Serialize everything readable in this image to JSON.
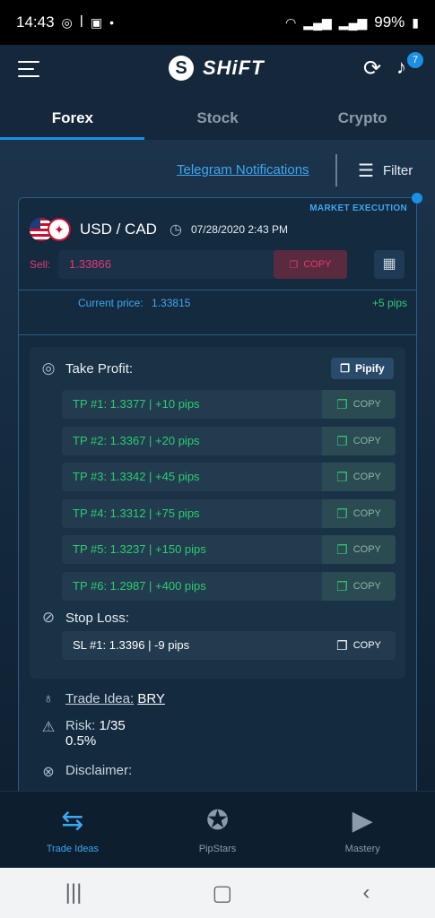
{
  "status": {
    "time": "14:43",
    "left_icons": [
      "whatsapp-icon",
      "shazam-icon",
      "shopping-bag-icon",
      "dot-icon"
    ],
    "battery": "99%"
  },
  "header": {
    "brand": "SHiFT",
    "notification_count": "7",
    "tabs": [
      "Forex",
      "Stock",
      "Crypto"
    ],
    "active_tab": "Forex"
  },
  "toolbar": {
    "telegram": "Telegram Notifications",
    "filter": "Filter"
  },
  "signal": {
    "execution": "MARKET EXECUTION",
    "pair": "USD / CAD",
    "datetime": "07/28/2020 2:43 PM",
    "sell_label": "Sell:",
    "sell_price": "1.33866",
    "copy_label": "COPY",
    "current_label": "Current price:",
    "current_price": "1.33815",
    "current_pips": "+5 pips",
    "take_profit_label": "Take Profit:",
    "pipify_label": "Pipify",
    "take_profits": [
      "TP #1: 1.3377 | +10 pips",
      "TP #2: 1.3367 | +20 pips",
      "TP #3: 1.3342 | +45 pips",
      "TP #4: 1.3312 | +75 pips",
      "TP #5: 1.3237 | +150 pips",
      "TP #6: 1.2987 | +400 pips"
    ],
    "stop_loss_label": "Stop Loss:",
    "stop_loss": "SL #1: 1.3396 | -9 pips",
    "trade_idea_label": "Trade Idea:",
    "trade_idea_value": "BRY",
    "risk_label": "Risk:",
    "risk_ratio": "1/35",
    "risk_percent": "0.5%",
    "disclaimer_label": "Disclaimer:"
  },
  "bottom_nav": [
    {
      "label": "Trade Ideas",
      "active": true
    },
    {
      "label": "PipStars",
      "active": false
    },
    {
      "label": "Mastery",
      "active": false
    }
  ],
  "colors": {
    "accent": "#1a8fe3",
    "sell": "#e43a6f",
    "profit": "#2ecc71"
  }
}
